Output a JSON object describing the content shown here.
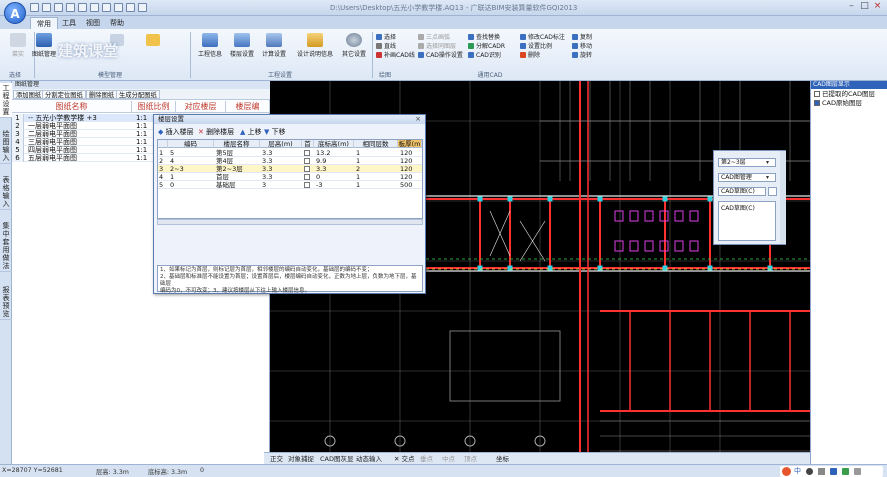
{
  "app": {
    "logo_letter": "A",
    "window_title": "D:\\Users\\Desktop\\五光小学教学楼.AQ13 - 广联达BIM安装算量软件GQI2013"
  },
  "menu_tabs": [
    "常用",
    "工具",
    "视图",
    "帮助"
  ],
  "ribbon": {
    "big_buttons": [
      "图纸管理",
      "工程信息",
      "楼层设置",
      "计算设置",
      "设计说明信息",
      "其它设置"
    ],
    "faded_button": "菜实",
    "groups": [
      "选择",
      "模型管理",
      "工程设置",
      "绘图"
    ],
    "small_tools_col1": [
      "选择",
      "直线",
      "补画CAD线"
    ],
    "small_tools_col2": [
      "三点画弧",
      "选择同图层",
      "CAD操作设置"
    ],
    "small_tools_col3": [
      "查找替换",
      "分解CADR",
      "CAD识别"
    ],
    "small_tools_col4": [
      "修改CAD标注",
      "设置比例",
      "删除"
    ],
    "small_tools_col5": [
      "复制",
      "移动",
      "旋转"
    ],
    "cad_group_label": "通用CAD"
  },
  "watermark": "建筑课堂",
  "left_tabs": [
    "工程设置",
    "绘图输入",
    "表格输入",
    "集中套用做法",
    "报表预览"
  ],
  "drawing_mgmt": {
    "title": "图纸管理",
    "buttons": [
      "添加图纸",
      "分割定位图纸",
      "删除图纸",
      "生成分配图纸"
    ],
    "headers": [
      "图纸名称",
      "图纸比例",
      "对应楼层",
      "楼层编"
    ],
    "rows": [
      {
        "n": "1",
        "name": "-- 五光小学教学楼 +3",
        "scale": "1:1"
      },
      {
        "n": "2",
        "name": "一层弱电平面图",
        "scale": "1:1"
      },
      {
        "n": "3",
        "name": "二层弱电平面图",
        "scale": "1:1"
      },
      {
        "n": "4",
        "name": "三层弱电平面图",
        "scale": "1:1"
      },
      {
        "n": "5",
        "name": "四层弱电平面图",
        "scale": "1:1"
      },
      {
        "n": "6",
        "name": "五层弱电平面图",
        "scale": "1:1"
      }
    ]
  },
  "floor_dialog": {
    "title": "楼层设置",
    "toolbar": [
      "插入楼层",
      "删除楼层",
      "上移",
      "下移"
    ],
    "headers": [
      "编码",
      "楼层名称",
      "层高(m)",
      "首",
      "底标高(m)",
      "相同层数",
      "板厚(m"
    ],
    "rows": [
      {
        "n": "1",
        "code": "5",
        "name": "第5层",
        "height": "3.3",
        "first": "",
        "base": "13.2",
        "same": "1",
        "thick": "120"
      },
      {
        "n": "2",
        "code": "4",
        "name": "第4层",
        "height": "3.3",
        "first": "",
        "base": "9.9",
        "same": "1",
        "thick": "120"
      },
      {
        "n": "3",
        "code": "2~3",
        "name": "第2~3层",
        "height": "3.3",
        "first": "",
        "base": "3.3",
        "same": "2",
        "thick": "120"
      },
      {
        "n": "4",
        "code": "1",
        "name": "首层",
        "height": "3.3",
        "first": "",
        "base": "0",
        "same": "1",
        "thick": "120"
      },
      {
        "n": "5",
        "code": "0",
        "name": "基础层",
        "height": "3",
        "first": "",
        "base": "-3",
        "same": "1",
        "thick": "500"
      }
    ],
    "hint_lines": [
      "1、如果标记为首层，则标记层为首层，相邻楼层的编码自动变化，基础层的编码不变；",
      "2、基础层和标准层不能设置为首层；设置首层后，楼层编码自动变化，正数为地上层，负数为地下层，基础层",
      "   编码为0，不可改变；3、建议按楼层从下往上输入楼层信息。"
    ]
  },
  "cad_status": [
    "正交",
    "对象捕捉",
    "CAD图灰显",
    "动态输入",
    "交点",
    "垂点",
    "中点",
    "顶点",
    "坐标"
  ],
  "right_panel": {
    "title": "CAD图层显示",
    "items": [
      "已提取的CAD图层",
      "CAD原始图层"
    ]
  },
  "float_win": {
    "selects": [
      "第2~3层",
      "CAD图管理",
      "CAD草图(C)"
    ],
    "list_item": "CAD草图(C)"
  },
  "statusbar": {
    "coords": "X=28707 Y=52681",
    "floor_height": "层高: 3.3m",
    "base_height": "底标高: 3.3m",
    "zero": "0"
  },
  "colors": {
    "accent": "#2f63b9",
    "cad_bg": "#000000",
    "cad_red": "#ff3030",
    "cad_white": "#e8e8e8",
    "cad_green": "#39d04a",
    "cad_yellow": "#e8e040",
    "cad_magenta": "#e040e8",
    "dialog_selected_row": "#fff6c8"
  }
}
